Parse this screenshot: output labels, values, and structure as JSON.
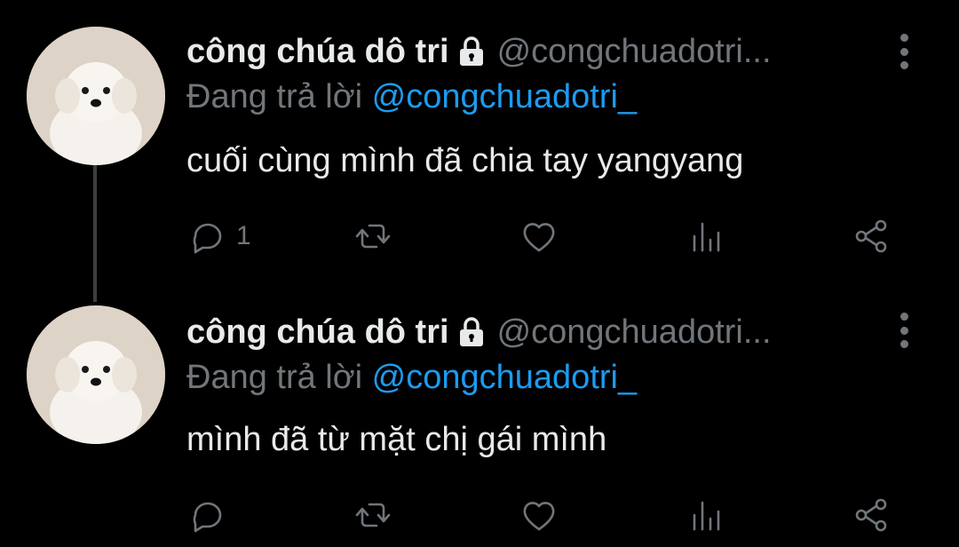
{
  "tweets": [
    {
      "display_name": "công chúa dô tri",
      "handle": "@congchuadotri...",
      "reply_prefix": "Đang trả lời ",
      "reply_to": "@congchuadotri_",
      "text": "cuối cùng mình đã chia tay yangyang",
      "reply_count": "1"
    },
    {
      "display_name": "công chúa dô tri",
      "handle": "@congchuadotri...",
      "reply_prefix": "Đang trả lời ",
      "reply_to": "@congchuadotri_",
      "text": "mình đã từ mặt chị gái mình",
      "reply_count": ""
    }
  ],
  "icons": {
    "lock": "lock-icon",
    "more": "more-vertical-icon",
    "reply": "reply-icon",
    "retweet": "retweet-icon",
    "like": "heart-icon",
    "views": "views-icon",
    "share": "share-icon"
  },
  "colors": {
    "background": "#000000",
    "text": "#e7e9ea",
    "muted": "#71767b",
    "mention": "#1d9bf0",
    "thread_line": "#3b3f44"
  }
}
